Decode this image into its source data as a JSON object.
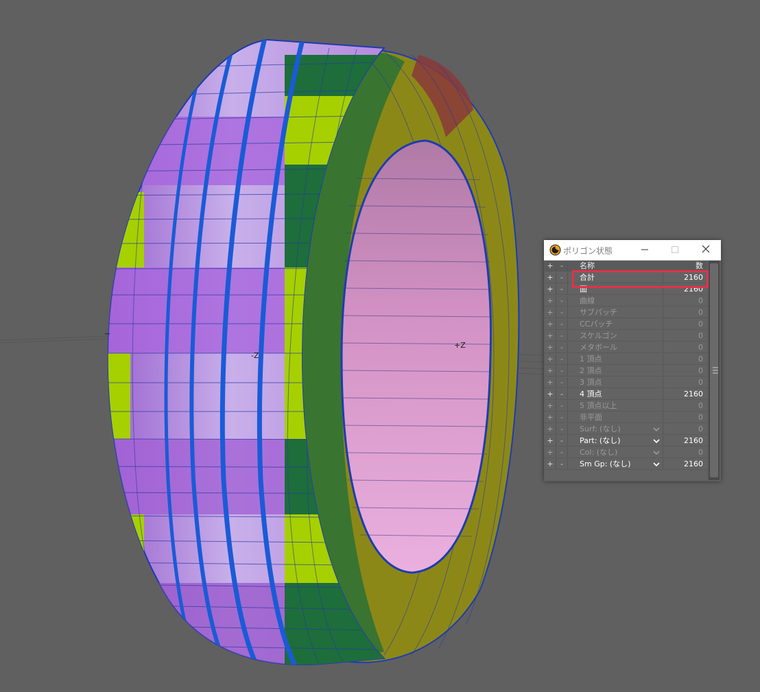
{
  "viewport": {
    "axis_labels": {
      "neg_z": "-Z",
      "pos_z": "+Z",
      "left_edge": "~"
    }
  },
  "panel": {
    "title": "ポリゴン状態",
    "header": {
      "plus": "+",
      "minus": "-",
      "name": "名称",
      "count": "数"
    },
    "rows": [
      {
        "plus": "+",
        "minus": "-",
        "name": "合計",
        "count": "2160",
        "dim": false,
        "dropdown": false
      },
      {
        "plus": "+",
        "minus": "-",
        "name": "面",
        "count": "2160",
        "dim": false,
        "dropdown": false
      },
      {
        "plus": "+",
        "minus": "-",
        "name": "曲線",
        "count": "0",
        "dim": true,
        "dropdown": false
      },
      {
        "plus": "+",
        "minus": "-",
        "name": "サブパッチ",
        "count": "0",
        "dim": true,
        "dropdown": false
      },
      {
        "plus": "+",
        "minus": "-",
        "name": "CCパッチ",
        "count": "0",
        "dim": true,
        "dropdown": false
      },
      {
        "plus": "+",
        "minus": "-",
        "name": "スケルゴン",
        "count": "0",
        "dim": true,
        "dropdown": false
      },
      {
        "plus": "+",
        "minus": "-",
        "name": "メタボール",
        "count": "0",
        "dim": true,
        "dropdown": false
      },
      {
        "plus": "+",
        "minus": "-",
        "name": "1 頂点",
        "count": "0",
        "dim": true,
        "dropdown": false
      },
      {
        "plus": "+",
        "minus": "-",
        "name": "2 頂点",
        "count": "0",
        "dim": true,
        "dropdown": false
      },
      {
        "plus": "+",
        "minus": "-",
        "name": "3 頂点",
        "count": "0",
        "dim": true,
        "dropdown": false
      },
      {
        "plus": "+",
        "minus": "-",
        "name": "4 頂点",
        "count": "2160",
        "dim": false,
        "dropdown": false
      },
      {
        "plus": "+",
        "minus": "-",
        "name": "5 頂点以上",
        "count": "0",
        "dim": true,
        "dropdown": false
      },
      {
        "plus": "+",
        "minus": "-",
        "name": "非平面",
        "count": "0",
        "dim": true,
        "dropdown": false
      },
      {
        "plus": "+",
        "minus": "-",
        "name": "Surf: (なし)",
        "count": "0",
        "dim": true,
        "dropdown": true
      },
      {
        "plus": "+",
        "minus": "-",
        "name": "Part: (なし)",
        "count": "2160",
        "dim": false,
        "dropdown": true
      },
      {
        "plus": "+",
        "minus": "-",
        "name": "Col: (なし)",
        "count": "0",
        "dim": true,
        "dropdown": true
      },
      {
        "plus": "+",
        "minus": "-",
        "name": "Sm Gp: (なし)",
        "count": "2160",
        "dim": false,
        "dropdown": true
      }
    ]
  },
  "colors": {
    "highlight": "#e0334a",
    "tread_light": "#c4a8e4",
    "tread_dark": "#a56fd8",
    "sidewall": "#8f8a14",
    "inner": "#e6a4d6"
  },
  "icons": {
    "app": "lightwave-icon",
    "minimize": "minimize-icon",
    "maximize": "maximize-icon",
    "close": "close-icon",
    "dropdown": "chevron-down-icon"
  }
}
